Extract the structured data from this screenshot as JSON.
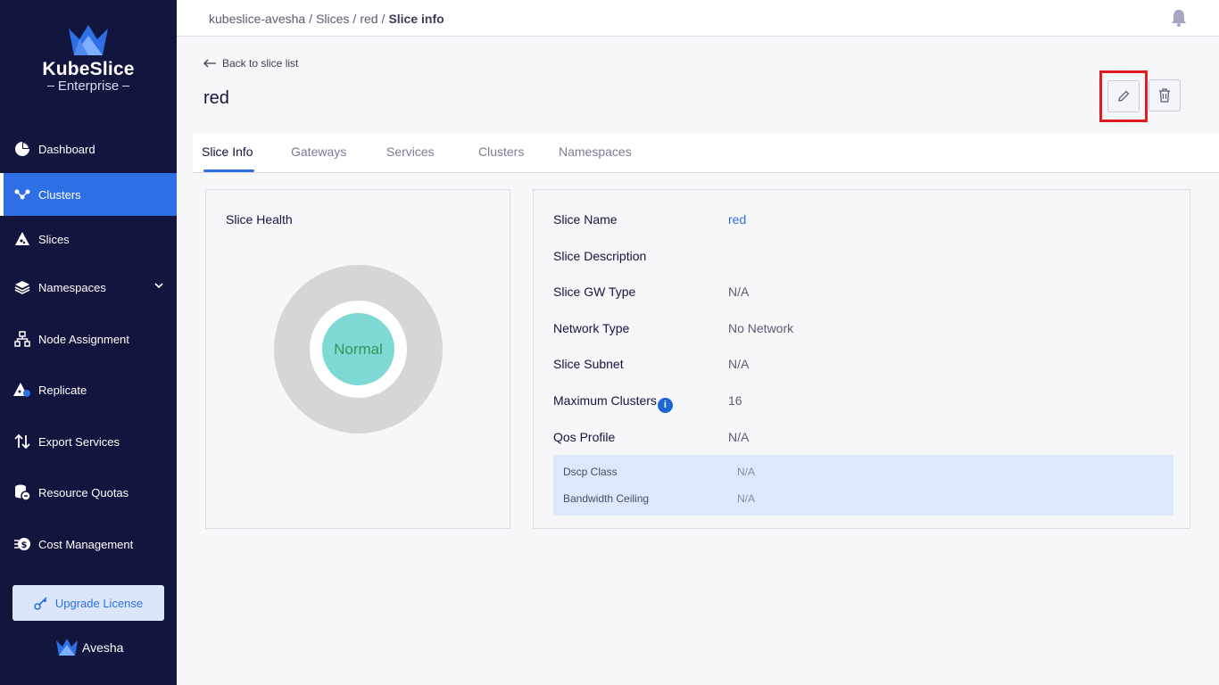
{
  "sidebar": {
    "brand_title": "KubeSlice",
    "brand_subtitle": "Enterprise",
    "items": [
      {
        "label": "Dashboard"
      },
      {
        "label": "Clusters"
      },
      {
        "label": "Slices"
      },
      {
        "label": "Namespaces"
      },
      {
        "label": "Node Assignment"
      },
      {
        "label": "Replicate"
      },
      {
        "label": "Export Services"
      },
      {
        "label": "Resource Quotas"
      },
      {
        "label": "Cost Management"
      }
    ],
    "active_item": "Clusters",
    "upgrade_label": "Upgrade License",
    "footer_brand": "Avesha"
  },
  "breadcrumb": {
    "parts": [
      "kubeslice-avesha",
      "Slices",
      "red"
    ],
    "current": "Slice info"
  },
  "page": {
    "back_label": "Back to slice list",
    "title": "red"
  },
  "tabs": [
    "Slice Info",
    "Gateways",
    "Services",
    "Clusters",
    "Namespaces"
  ],
  "active_tab": "Slice Info",
  "health": {
    "title": "Slice Health",
    "status": "Normal"
  },
  "info": {
    "rows": [
      {
        "key": "Slice Name",
        "value": "red"
      },
      {
        "key": "Slice Description",
        "value": ""
      },
      {
        "key": "Slice GW Type",
        "value": "N/A"
      },
      {
        "key": "Network Type",
        "value": "No Network"
      },
      {
        "key": "Slice Subnet",
        "value": "N/A"
      },
      {
        "key": "Maximum Clusters",
        "value": "16",
        "info_glyph": "i"
      },
      {
        "key": "Qos Profile",
        "value": "N/A"
      }
    ],
    "qos": [
      {
        "key": "Dscp Class",
        "value": "N/A"
      },
      {
        "key": "Bandwidth Ceiling",
        "value": "N/A"
      }
    ]
  },
  "colors": {
    "sidebar_bg": "#12153e",
    "accent": "#2f6fe6",
    "highlight_border": "#e01b24",
    "health_ring": "#d6d6d6",
    "health_normal": "#7ed8d3"
  }
}
